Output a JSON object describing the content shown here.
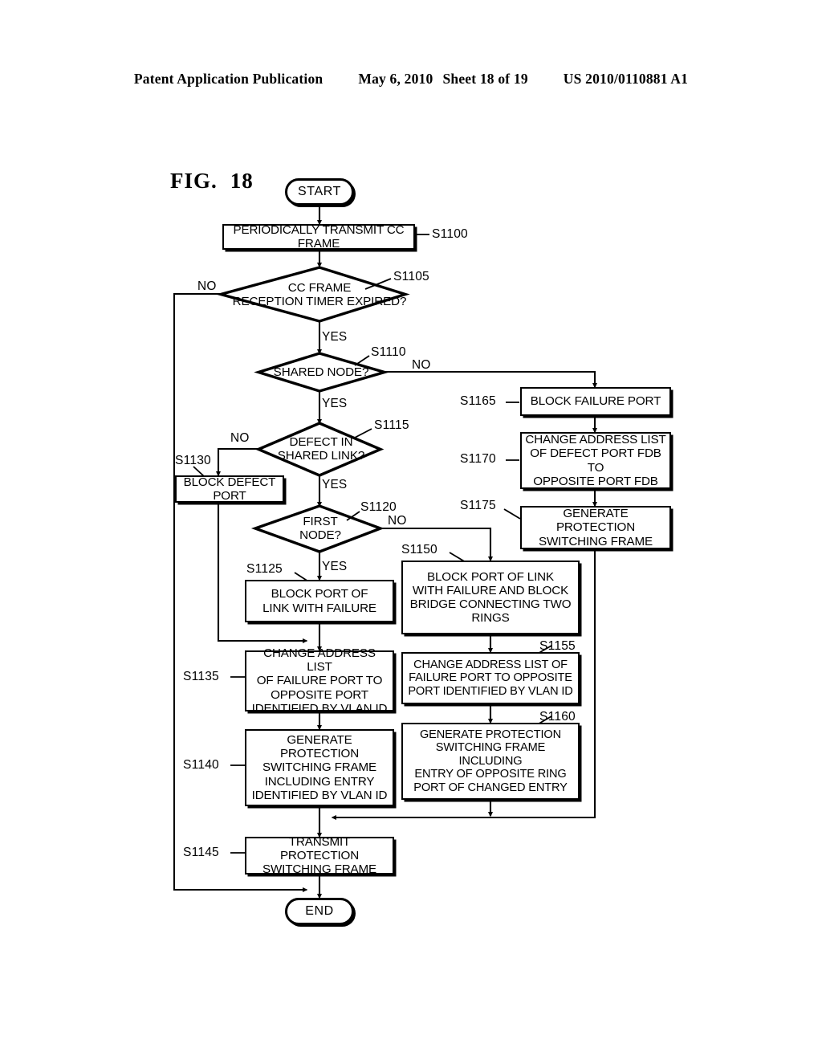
{
  "header": {
    "publication": "Patent Application Publication",
    "date": "May 6, 2010",
    "sheet": "Sheet 18 of 19",
    "docnumber": "US 2010/0110881 A1"
  },
  "figure": {
    "label": "FIG.",
    "number": "18"
  },
  "terminals": {
    "start": "START",
    "end": "END"
  },
  "nodes": {
    "s1100": {
      "ref": "S1100",
      "text": "PERIODICALLY TRANSMIT CC FRAME"
    },
    "s1105": {
      "ref": "S1105",
      "line1": "CC FRAME",
      "line2": "RECEPTION TIMER EXPIRED?"
    },
    "s1110": {
      "ref": "S1110",
      "line1": "SHARED NODE?"
    },
    "s1115": {
      "ref": "S1115",
      "line1": "DEFECT IN",
      "line2": "SHARED LINK?"
    },
    "s1120": {
      "ref": "S1120",
      "line1": "FIRST",
      "line2": "NODE?"
    },
    "s1125": {
      "ref": "S1125",
      "line1": "BLOCK PORT OF",
      "line2": "LINK WITH FAILURE"
    },
    "s1130": {
      "ref": "S1130",
      "text": "BLOCK DEFECT PORT"
    },
    "s1135": {
      "ref": "S1135",
      "line1": "CHANGE ADDRESS LIST",
      "line2": "OF FAILURE PORT TO",
      "line3": "OPPOSITE PORT",
      "line4": "IDENTIFIED BY VLAN ID"
    },
    "s1140": {
      "ref": "S1140",
      "line1": "GENERATE PROTECTION",
      "line2": "SWITCHING FRAME",
      "line3": "INCLUDING ENTRY",
      "line4": "IDENTIFIED BY VLAN ID"
    },
    "s1145": {
      "ref": "S1145",
      "line1": "TRANSMIT PROTECTION",
      "line2": "SWITCHING FRAME"
    },
    "s1150": {
      "ref": "S1150",
      "line1": "BLOCK PORT OF LINK",
      "line2": "WITH FAILURE AND BLOCK",
      "line3": "BRIDGE CONNECTING TWO",
      "line4": "RINGS"
    },
    "s1155": {
      "ref": "S1155",
      "line1": "CHANGE ADDRESS LIST OF",
      "line2": "FAILURE PORT TO OPPOSITE",
      "line3": "PORT IDENTIFIED BY VLAN ID"
    },
    "s1160": {
      "ref": "S1160",
      "line1": "GENERATE PROTECTION",
      "line2": "SWITCHING FRAME  INCLUDING",
      "line3": "ENTRY OF OPPOSITE RING",
      "line4": "PORT OF CHANGED ENTRY"
    },
    "s1165": {
      "ref": "S1165",
      "text": "BLOCK FAILURE PORT"
    },
    "s1170": {
      "ref": "S1170",
      "line1": "CHANGE ADDRESS LIST",
      "line2": "OF DEFECT PORT FDB TO",
      "line3": "OPPOSITE PORT FDB"
    },
    "s1175": {
      "ref": "S1175",
      "line1": "GENERATE PROTECTION",
      "line2": "SWITCHING FRAME"
    }
  },
  "branches": {
    "s1105_no": "NO",
    "s1105_yes": "YES",
    "s1110_no": "NO",
    "s1110_yes": "YES",
    "s1115_no": "NO",
    "s1115_yes": "YES",
    "s1120_no": "NO",
    "s1120_yes": "YES"
  }
}
